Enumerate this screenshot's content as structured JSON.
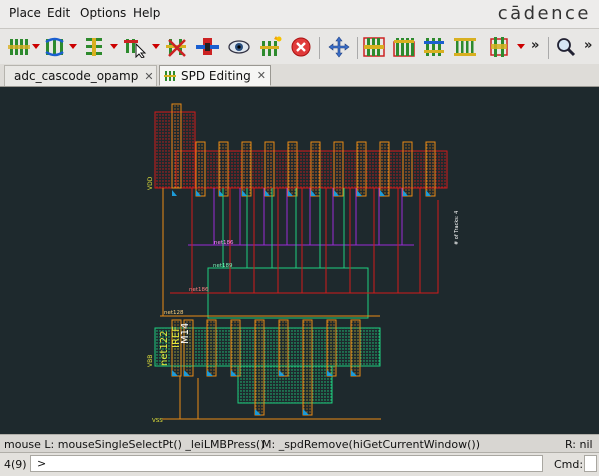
{
  "menu": {
    "items": [
      "Place",
      "Edit",
      "Options",
      "Help"
    ],
    "brand": "cādence"
  },
  "toolbar": {
    "icons": [
      "place-pins-icon",
      "swap-icon",
      "align-icon",
      "select-icon",
      "route-icon",
      "probe-icon",
      "view-eye-icon",
      "add-icon",
      "delete-icon",
      "pan-icon",
      "fingers-1-icon",
      "fingers-2-icon",
      "fingers-3-icon",
      "fingers-4-icon",
      "bus-icon",
      "search-icon"
    ],
    "overflow": "»"
  },
  "tabs": [
    {
      "label": "adc_cascode_opamp",
      "close": "✕",
      "active": false
    },
    {
      "label": "SPD Editing",
      "close": "✕",
      "active": true
    }
  ],
  "canvas": {
    "labels": {
      "vdd": "VDD",
      "vss": "VSS",
      "vbb": "VBB",
      "net186a": "net186",
      "net189": "net189",
      "net186b": "net186",
      "net128": "net128",
      "net122": "net122",
      "iref": "IREF",
      "m14": "M14",
      "tracks": "# of Tracks: 4"
    },
    "colors": {
      "background": "#1e292d",
      "red": "#d21a1a",
      "orange": "#e98a15",
      "green": "#1fcf7f",
      "purple": "#9b2bd8",
      "yellow": "#e5e53a",
      "blue": "#1d9bd8"
    }
  },
  "status": {
    "mouse_l": "mouse L: mouseSingleSelectPt() _leiLMBPress()",
    "mouse_m": "M: _spdRemove(hiGetCurrentWindow())",
    "mouse_r": "R: nil"
  },
  "cmd": {
    "count": "4(9)",
    "prompt": ">",
    "label": "Cmd:"
  }
}
